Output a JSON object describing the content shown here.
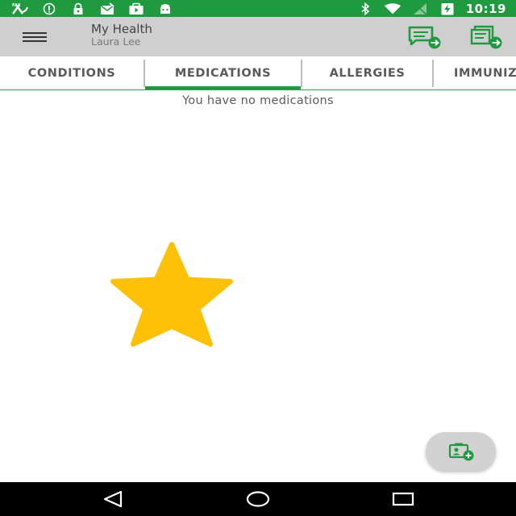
{
  "status_bar": {
    "time": "10:19",
    "background": "#1f9a3f",
    "left_icons": [
      "fax-icon",
      "info-icon",
      "lock-icon",
      "mail-icon",
      "play-store-icon",
      "android-debug-icon"
    ],
    "right_icons": [
      "bluetooth-icon",
      "wifi-icon",
      "signal-off-icon",
      "battery-charging-icon"
    ]
  },
  "app_bar": {
    "title": "My Health",
    "subtitle": "Laura Lee",
    "background": "#cfcfcf",
    "actions": [
      "send-message-icon",
      "send-record-icon"
    ]
  },
  "tabs": {
    "items": [
      {
        "label": "CONDITIONS"
      },
      {
        "label": "MEDICATIONS"
      },
      {
        "label": "ALLERGIES"
      },
      {
        "label": "IMMUNIZATIONS"
      }
    ],
    "selected": "MEDICATIONS",
    "accent": "#1f9a3f"
  },
  "content": {
    "empty_message": "You have no medications",
    "graphic": "star-icon",
    "graphic_color": "#ffc107"
  },
  "fab": {
    "icon": "add-record-icon"
  },
  "nav_bar": {
    "buttons": [
      "back-icon",
      "home-icon",
      "recents-icon"
    ]
  }
}
